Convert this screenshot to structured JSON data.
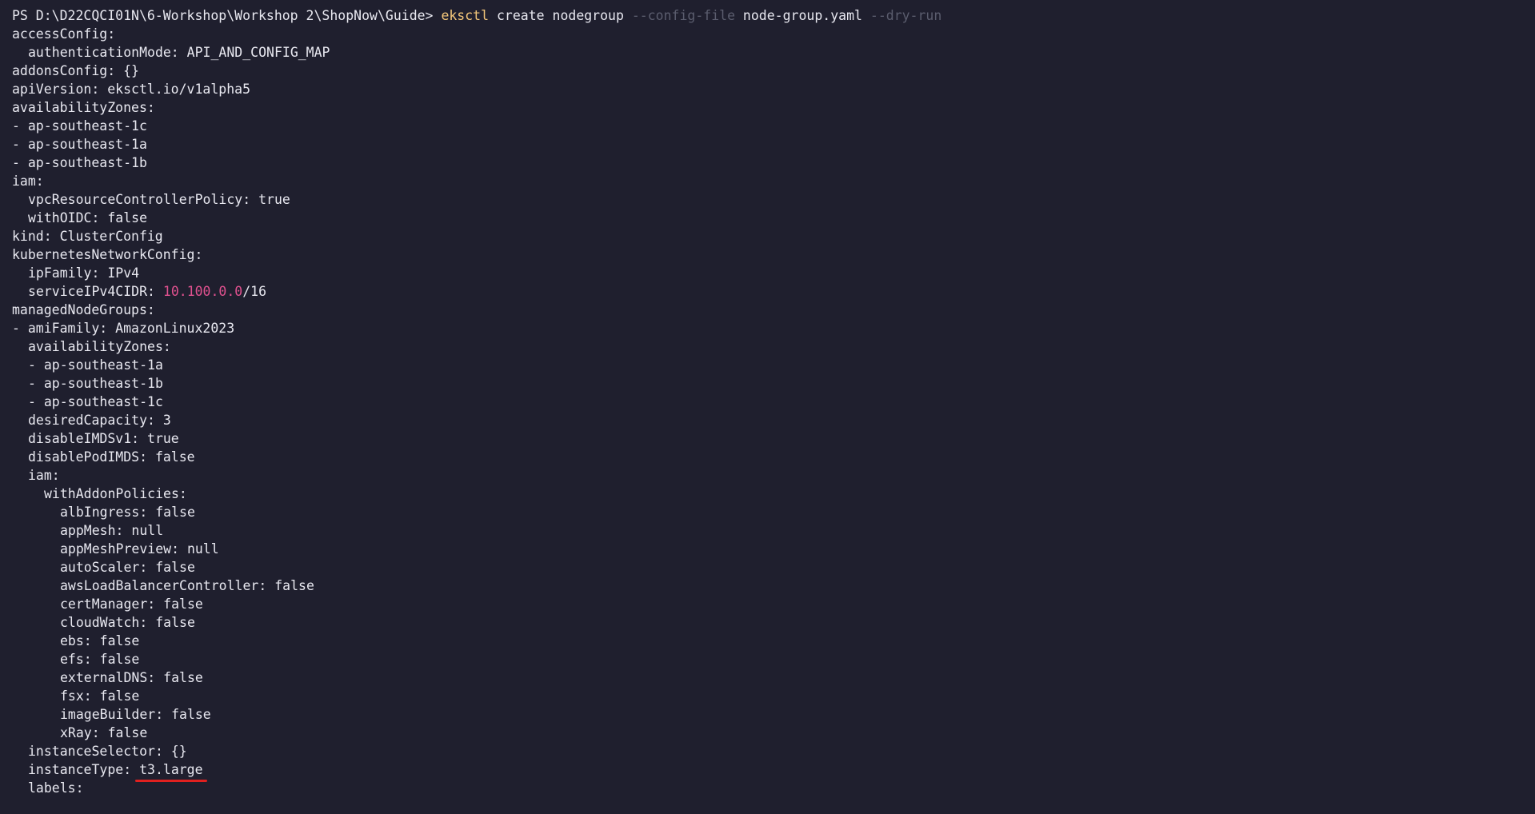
{
  "prompt": {
    "ps": "PS D:\\D22CQCI01N\\6-Workshop\\Workshop 2\\ShopNow\\Guide> ",
    "command": "eksctl",
    "arg1": " create nodegroup ",
    "flag1": "--config-file",
    "arg2": " node-group.yaml ",
    "flag2": "--dry-run"
  },
  "lines": {
    "l1": "accessConfig:",
    "l2": "authenticationMode: API_AND_CONFIG_MAP",
    "l3": "addonsConfig: {}",
    "l4": "apiVersion: eksctl.io/v1alpha5",
    "l5": "availabilityZones:",
    "l6": "- ap-southeast-1c",
    "l7": "- ap-southeast-1a",
    "l8": "- ap-southeast-1b",
    "l9": "iam:",
    "l10": "vpcResourceControllerPolicy: true",
    "l11": "withOIDC: false",
    "l12": "kind: ClusterConfig",
    "l13": "kubernetesNetworkConfig:",
    "l14": "ipFamily: IPv4",
    "l15_key": "serviceIPv4CIDR: ",
    "l15_ip": "10.100.0.0",
    "l15_mask": "/16",
    "l16": "managedNodeGroups:",
    "l17": "- amiFamily: AmazonLinux2023",
    "l18": "availabilityZones:",
    "l19": "- ap-southeast-1a",
    "l20": "- ap-southeast-1b",
    "l21": "- ap-southeast-1c",
    "l22": "desiredCapacity: 3",
    "l23": "disableIMDSv1: true",
    "l24": "disablePodIMDS: false",
    "l25": "iam:",
    "l26": "withAddonPolicies:",
    "l27": "albIngress: false",
    "l28": "appMesh: null",
    "l29": "appMeshPreview: null",
    "l30": "autoScaler: false",
    "l31": "awsLoadBalancerController: false",
    "l32": "certManager: false",
    "l33": "cloudWatch: false",
    "l34": "ebs: false",
    "l35": "efs: false",
    "l36": "externalDNS: false",
    "l37": "fsx: false",
    "l38": "imageBuilder: false",
    "l39": "xRay: false",
    "l40": "instanceSelector: {}",
    "l41_key": "instanceType: ",
    "l41_val": "t3.large",
    "l42": "labels:"
  }
}
